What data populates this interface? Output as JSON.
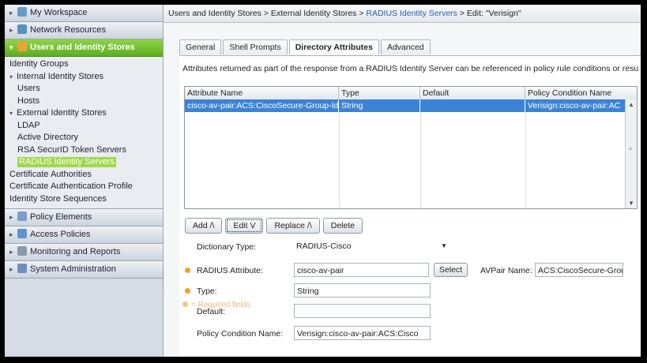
{
  "sidebar": {
    "drawers_top": [
      {
        "label": "My Workspace",
        "icon": "workspace-icon",
        "color": "#6a9acb"
      },
      {
        "label": "Network Resources",
        "icon": "network-icon",
        "color": "#5c8fc4"
      }
    ],
    "active_drawer": {
      "label": "Users and Identity Stores",
      "icon": "users-icon",
      "color": "#e9a437"
    },
    "tree": [
      {
        "label": "Identity Groups",
        "level": 0,
        "toggle": ""
      },
      {
        "label": "Internal Identity Stores",
        "level": 0,
        "toggle": "▾"
      },
      {
        "label": "Users",
        "level": 1,
        "toggle": ""
      },
      {
        "label": "Hosts",
        "level": 1,
        "toggle": ""
      },
      {
        "label": "External Identity Stores",
        "level": 0,
        "toggle": "▾"
      },
      {
        "label": "LDAP",
        "level": 1,
        "toggle": ""
      },
      {
        "label": "Active Directory",
        "level": 1,
        "toggle": ""
      },
      {
        "label": "RSA SecurID Token Servers",
        "level": 1,
        "toggle": ""
      },
      {
        "label": "RADIUS Identity Servers",
        "level": 1,
        "toggle": "",
        "selected": true
      },
      {
        "label": "Certificate Authorities",
        "level": 0,
        "toggle": ""
      },
      {
        "label": "Certificate Authentication Profile",
        "level": 0,
        "toggle": ""
      },
      {
        "label": "Identity Store Sequences",
        "level": 0,
        "toggle": ""
      }
    ],
    "drawers_bottom": [
      {
        "label": "Policy Elements",
        "icon": "policy-elements-icon",
        "color": "#7aa0c8"
      },
      {
        "label": "Access Policies",
        "icon": "access-policies-icon",
        "color": "#5d93cf"
      },
      {
        "label": "Monitoring and Reports",
        "icon": "monitoring-icon",
        "color": "#8899aa"
      },
      {
        "label": "System Administration",
        "icon": "system-admin-icon",
        "color": "#6d8fbf"
      }
    ]
  },
  "breadcrumb": {
    "part1": "Users and Identity Stores",
    "sep": " > ",
    "part2": "External Identity Stores",
    "part3": "RADIUS Identity Servers",
    "part4": "Edit: \"Verisign\""
  },
  "tabs": [
    "General",
    "Shell Prompts",
    "Directory Attributes",
    "Advanced"
  ],
  "active_tab": "Directory Attributes",
  "description": "Attributes returned as part of the response from a RADIUS Identity Server can be referenced in policy rule conditions or resu",
  "table": {
    "columns": [
      "Attribute Name",
      "Type",
      "Default",
      "Policy Condition Name"
    ],
    "rows": [
      [
        "cisco-av-pair:ACS:CiscoSecure-Group-Id",
        "String",
        "",
        "Verisign:cisco-av-pair:AC"
      ]
    ]
  },
  "buttons": {
    "add": "Add /\\",
    "edit": "Edit V",
    "replace": "Replace /\\",
    "delete": "Delete"
  },
  "form": {
    "dictionary_type_label": "Dictionary Type:",
    "dictionary_type_value": "RADIUS-Cisco",
    "radius_attribute_label": "RADIUS Attribute:",
    "radius_attribute_value": "cisco-av-pair",
    "select_label": "Select",
    "avpair_label": "AVPair Name:",
    "avpair_value": "ACS:CiscoSecure-Grou",
    "type_label": "Type:",
    "type_value": "String",
    "default_label": "Default:",
    "default_value": "",
    "policy_condition_label": "Policy Condition Name:",
    "policy_condition_value": "Verisign:cisco-av-pair:ACS:Cisco"
  },
  "footer_note": "= Required fields",
  "colors": {
    "accent_green": "#8fd34a",
    "selection_blue": "#3b83d6",
    "required_orange": "#f0a22a",
    "link_blue": "#2a5db0"
  }
}
